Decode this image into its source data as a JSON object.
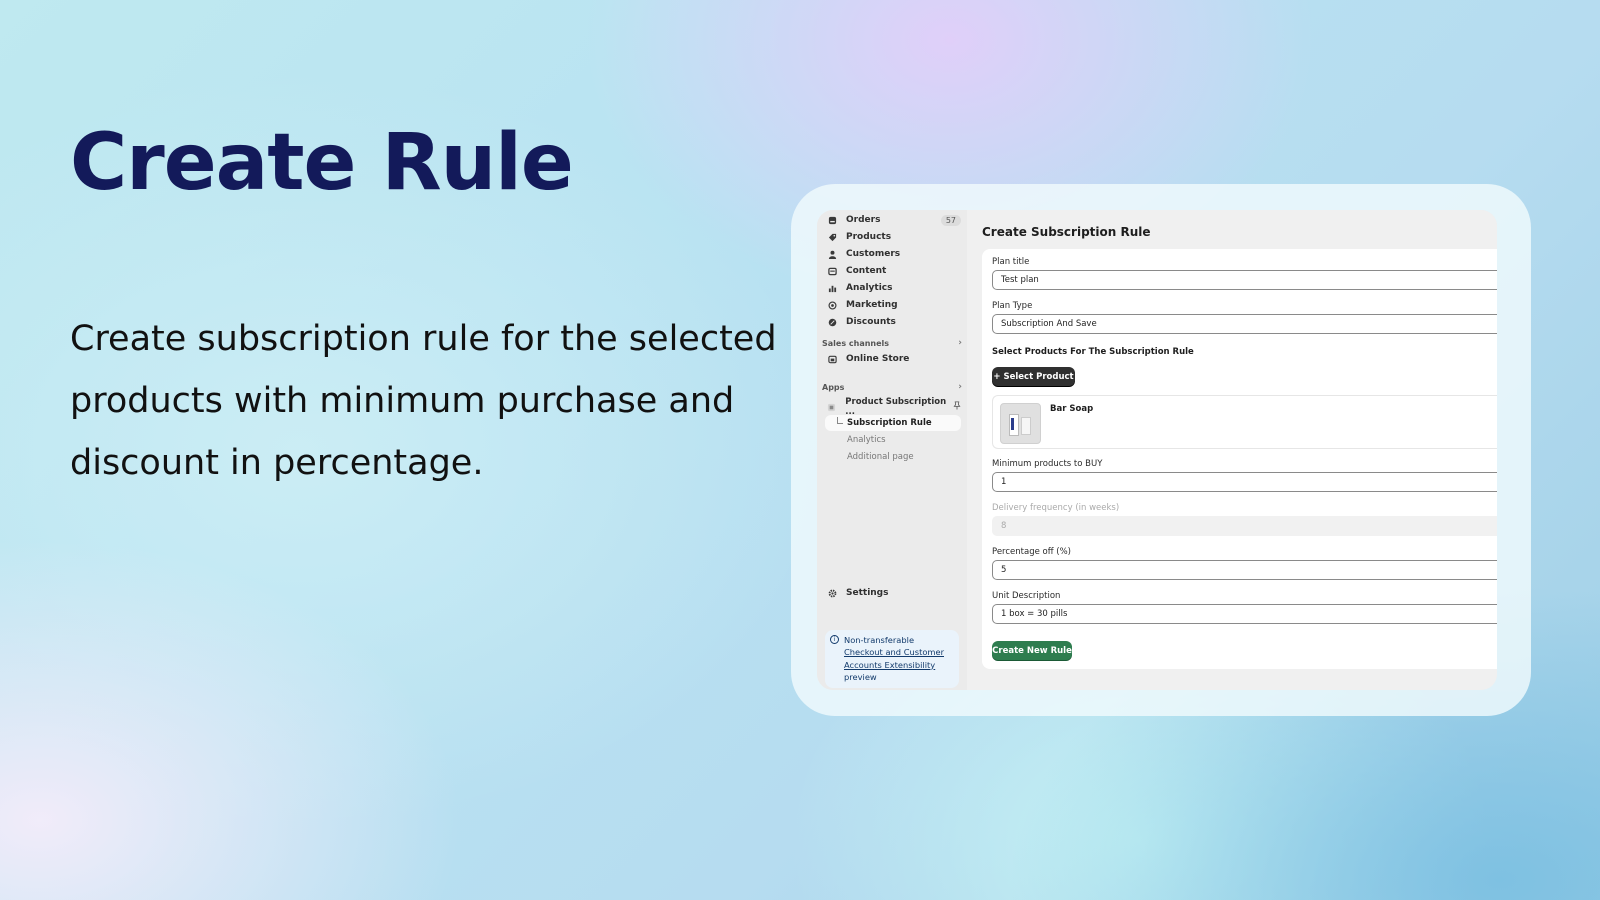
{
  "hero": {
    "title": "Create Rule",
    "description": "Create subscription rule for the selected products with minimum purchase and discount in percentage."
  },
  "sidebar": {
    "items": [
      {
        "label": "Orders",
        "badge": "57",
        "icon": "orders-icon"
      },
      {
        "label": "Products",
        "icon": "tag-icon"
      },
      {
        "label": "Customers",
        "icon": "person-icon"
      },
      {
        "label": "Content",
        "icon": "content-icon"
      },
      {
        "label": "Analytics",
        "icon": "bar-chart-icon"
      },
      {
        "label": "Marketing",
        "icon": "target-icon"
      },
      {
        "label": "Discounts",
        "icon": "discount-icon"
      }
    ],
    "sales_channels": {
      "heading": "Sales channels",
      "items": [
        {
          "label": "Online Store",
          "icon": "store-icon"
        }
      ]
    },
    "apps": {
      "heading": "Apps",
      "app_name": "Product Subscription ...",
      "sub_items": [
        {
          "label": "Subscription Rule",
          "active": true
        },
        {
          "label": "Analytics",
          "active": false
        },
        {
          "label": "Additional page",
          "active": false
        }
      ]
    },
    "settings_label": "Settings",
    "notice": {
      "title": "Non-transferable",
      "link": "Checkout and Customer Accounts Extensibility",
      "suffix": "preview"
    }
  },
  "main": {
    "title": "Create Subscription Rule",
    "fields": {
      "plan_title": {
        "label": "Plan title",
        "value": "Test plan"
      },
      "plan_type": {
        "label": "Plan Type",
        "value": "Subscription And Save"
      },
      "min_products": {
        "label": "Minimum products to BUY",
        "value": "1"
      },
      "delivery_frequency": {
        "label": "Delivery frequency (in weeks)",
        "value": "8",
        "disabled": true
      },
      "percentage_off": {
        "label": "Percentage off (%)",
        "value": "5"
      },
      "unit_description": {
        "label": "Unit Description",
        "value": "1 box = 30 pills"
      }
    },
    "products_section_title": "Select Products For The Subscription Rule",
    "select_product_button": "+ Select Product",
    "selected_products": [
      {
        "name": "Bar Soap"
      }
    ],
    "create_button": "Create New Rule"
  },
  "colors": {
    "headline": "#131a5a",
    "primary_button": "#303030",
    "create_button": "#2e7d4f"
  }
}
